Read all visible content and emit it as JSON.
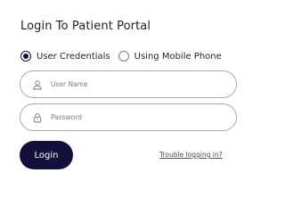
{
  "page": {
    "title": "Login To Patient Portal"
  },
  "login_method": {
    "options": [
      {
        "label": "User Credentials",
        "selected": true
      },
      {
        "label": "Using Mobile Phone",
        "selected": false
      }
    ]
  },
  "form": {
    "username": {
      "placeholder": "User Name",
      "value": "",
      "icon": "user-icon"
    },
    "password": {
      "placeholder": "Password",
      "value": "",
      "icon": "lock-icon"
    },
    "login_label": "Login",
    "trouble_label": "Trouble logging in?"
  },
  "colors": {
    "primary": "#14103d",
    "border": "#a9a9b6",
    "placeholder": "#7a7a85",
    "text": "#1f1f2e"
  }
}
